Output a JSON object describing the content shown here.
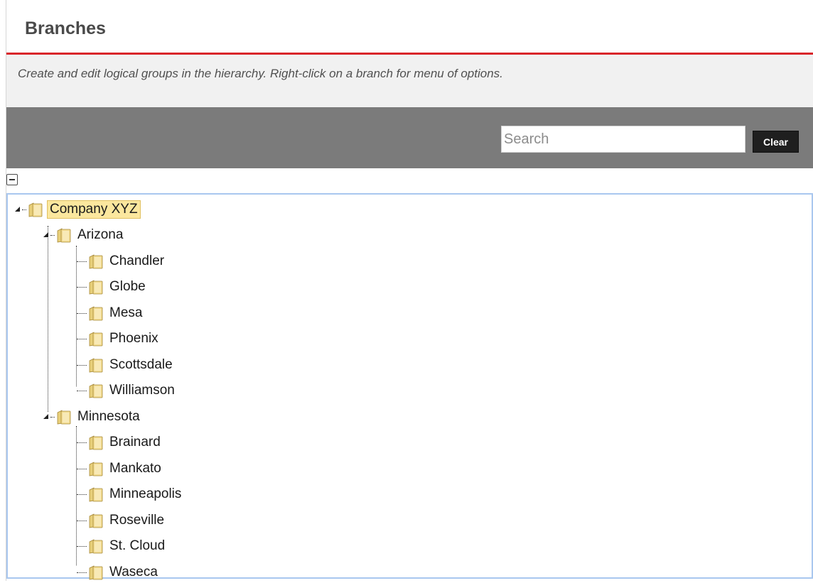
{
  "header": {
    "title": "Branches"
  },
  "description": "Create and edit logical groups in the hierarchy. Right-click on a branch for menu of options.",
  "toolbar": {
    "search_placeholder": "Search",
    "clear_label": "Clear"
  },
  "tree": {
    "root": "Company XYZ",
    "groups": [
      {
        "label": "Arizona",
        "children": [
          "Chandler",
          "Globe",
          "Mesa",
          "Phoenix",
          "Scottsdale",
          "Williamson"
        ]
      },
      {
        "label": "Minnesota",
        "children": [
          "Brainard",
          "Mankato",
          "Minneapolis",
          "Roseville",
          "St. Cloud",
          "Waseca"
        ]
      }
    ]
  },
  "colors": {
    "accent_red": "#d9262b",
    "toolbar_gray": "#7b7b7b",
    "selection": "#fbe79e",
    "tree_border": "#a9c7ef"
  }
}
